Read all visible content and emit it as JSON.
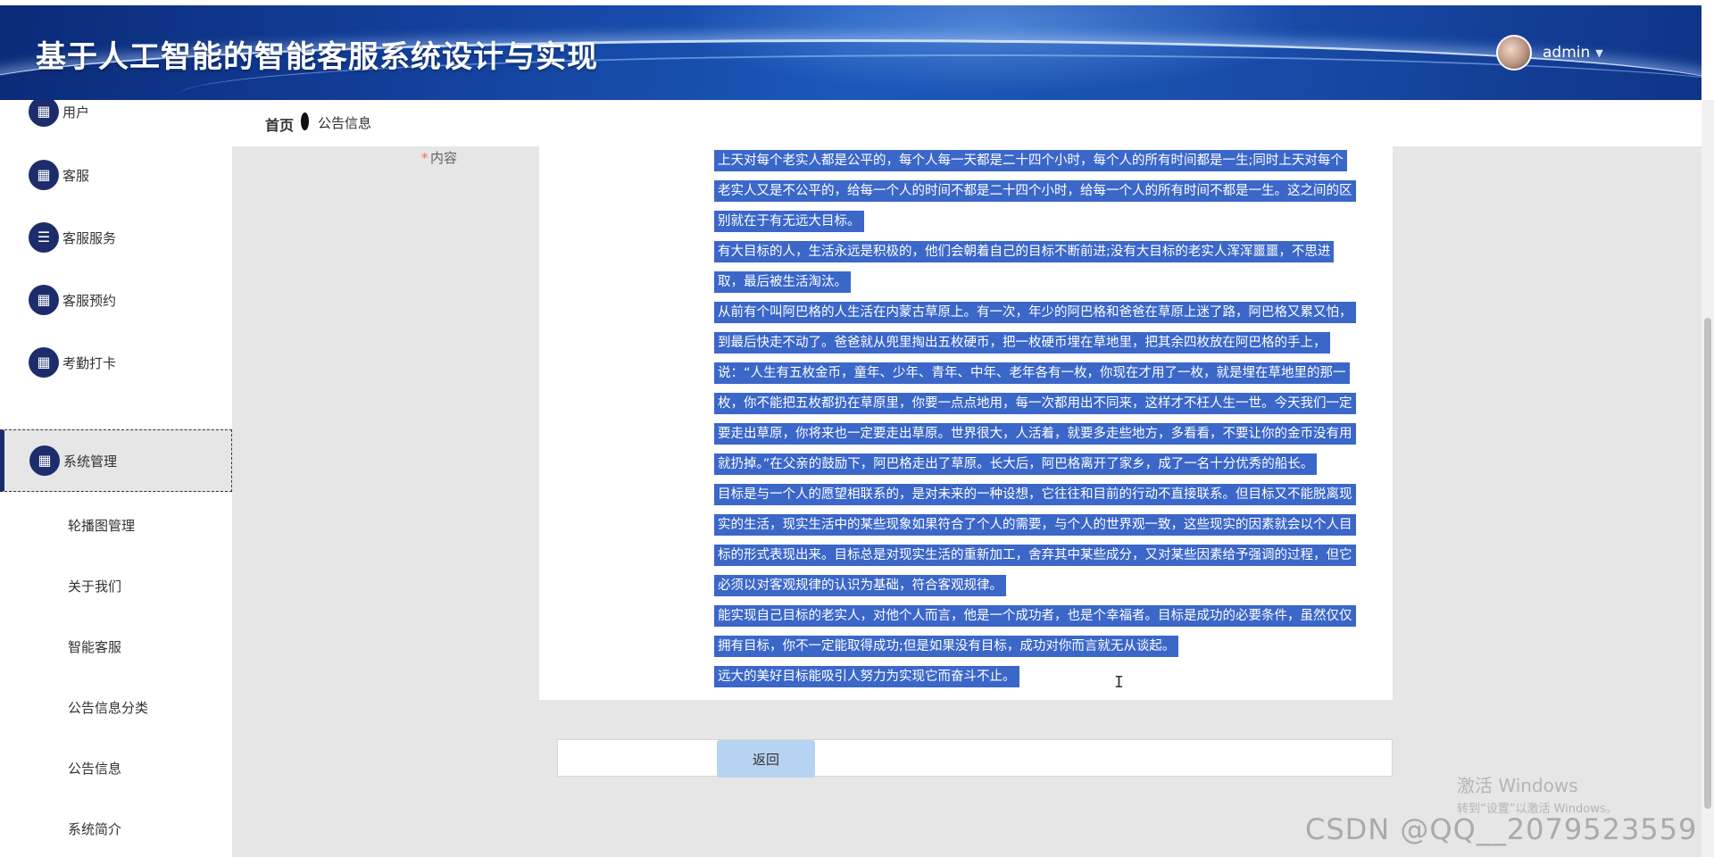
{
  "header": {
    "title": "基于人工智能的智能客服系统设计与实现",
    "username": "admin",
    "caret_icon": "caret-down-icon"
  },
  "breadcrumb": {
    "home": "首页",
    "current": "公告信息"
  },
  "sidebar": {
    "items": [
      {
        "label": "用户",
        "icon": "grid-icon"
      },
      {
        "label": "客服",
        "icon": "grid-icon"
      },
      {
        "label": "客服服务",
        "icon": "sliders-icon"
      },
      {
        "label": "客服预约",
        "icon": "grid-icon"
      },
      {
        "label": "考勤打卡",
        "icon": "grid-icon"
      },
      {
        "label": "系统管理",
        "icon": "grid-icon",
        "active": true
      }
    ],
    "subitems": [
      "轮播图管理",
      "关于我们",
      "智能客服",
      "公告信息分类",
      "公告信息",
      "系统简介"
    ]
  },
  "form": {
    "required_mark": "*",
    "content_label": "内容",
    "content_lines": [
      " 上天对每个老实人都是公平的，每个人每一天都是二十四个小时，每个人的所有时间都是一生;同时上天对每个",
      "老实人又是不公平的，给每一个人的时间不都是二十四个小时，给每一个人的所有时间不都是一生。这之间的区",
      "别就在于有无远大目标。",
      "  有大目标的人，生活永远是积极的，他们会朝着自己的目标不断前进;没有大目标的老实人浑浑噩噩，不思进",
      "取，最后被生活淘汰。",
      " 从前有个叫阿巴格的人生活在内蒙古草原上。有一次，年少的阿巴格和爸爸在草原上迷了路，阿巴格又累又怕，",
      "到最后快走不动了。爸爸就从兜里掏出五枚硬币，把一枚硬币埋在草地里，把其余四枚放在阿巴格的手上，",
      "说：“人生有五枚金币，童年、少年、青年、中年、老年各有一枚，你现在才用了一枚，就是埋在草地里的那一",
      "枚，你不能把五枚都扔在草原里，你要一点点地用，每一次都用出不同来，这样才不枉人生一世。今天我们一定",
      "要走出草原，你将来也一定要走出草原。世界很大，人活着，就要多走些地方，多看看，不要让你的金币没有用",
      "就扔掉。”在父亲的鼓励下，阿巴格走出了草原。长大后，阿巴格离开了家乡，成了一名十分优秀的船长。",
      " 目标是与一个人的愿望相联系的，是对未来的一种设想，它往往和目前的行动不直接联系。但目标又不能脱离现",
      "实的生活，现实生活中的某些现象如果符合了个人的需要，与个人的世界观一致，这些现实的因素就会以个人目",
      "标的形式表现出来。目标总是对现实生活的重新加工，舍弃其中某些成分，又对某些因素给予强调的过程，但它",
      "必须以对客观规律的认识为基础，符合客观规律。",
      " 能实现自己目标的老实人，对他个人而言，他是一个成功者，也是个幸福者。目标是成功的必要条件，虽然仅仅",
      "拥有目标，你不一定能取得成功;但是如果没有目标，成功对你而言就无从谈起。",
      "远大的美好目标能吸引人努力为实现它而奋斗不止。"
    ],
    "back_button": "返回"
  },
  "overlays": {
    "activate_title": "激活 Windows",
    "activate_sub": "转到“设置”以激活 Windows。",
    "watermark": "CSDN @QQ__2079523559"
  },
  "colors": {
    "header_blue": "#13409b",
    "icon_navy": "#1d2d6b",
    "selection_blue": "#3b67c9",
    "button_blue": "#b7d3f2",
    "required_red": "#f56c6c"
  }
}
